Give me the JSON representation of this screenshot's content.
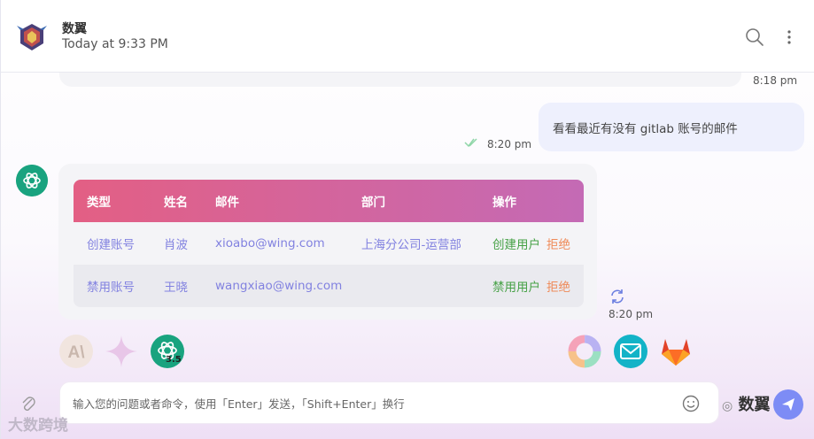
{
  "header": {
    "title": "数翼",
    "subtitle": "Today at 9:33 PM"
  },
  "messages": {
    "prev_time": "8:18 pm",
    "outgoing_text": "看看最近有没有 gitlab 账号的邮件",
    "outgoing_time": "8:20 pm",
    "incoming_time": "8:20 pm"
  },
  "table": {
    "headers": [
      "类型",
      "姓名",
      "邮件",
      "部门",
      "操作"
    ],
    "rows": [
      {
        "type": "创建账号",
        "name": "肖波",
        "email": "xioabo@wing.com",
        "dept": "上海分公司-运营部",
        "action": "创建用户",
        "reject": "拒绝"
      },
      {
        "type": "禁用账号",
        "name": "王晓",
        "email": "wangxiao@wing.com",
        "dept": "",
        "action": "禁用用户",
        "reject": "拒绝"
      }
    ]
  },
  "models": {
    "count": "3.5",
    "icons": [
      "anthropic-icon",
      "gemini-icon",
      "openai-icon",
      "colorful-ring-icon",
      "mail-icon",
      "gitlab-icon"
    ]
  },
  "input": {
    "placeholder": "输入您的问题或者命令，使用「Enter」发送，「Shift+Enter」换行"
  },
  "watermarks": {
    "left": "大数跨境",
    "right": "数翼"
  },
  "colors": {
    "table_header_start": "#e35f84",
    "table_header_end": "#c46ab5",
    "link": "#8282e0",
    "confirm": "#46a146",
    "reject": "#ef8a58",
    "outgoing_bubble": "#eef0fd",
    "send_button": "#7d8cf5"
  }
}
